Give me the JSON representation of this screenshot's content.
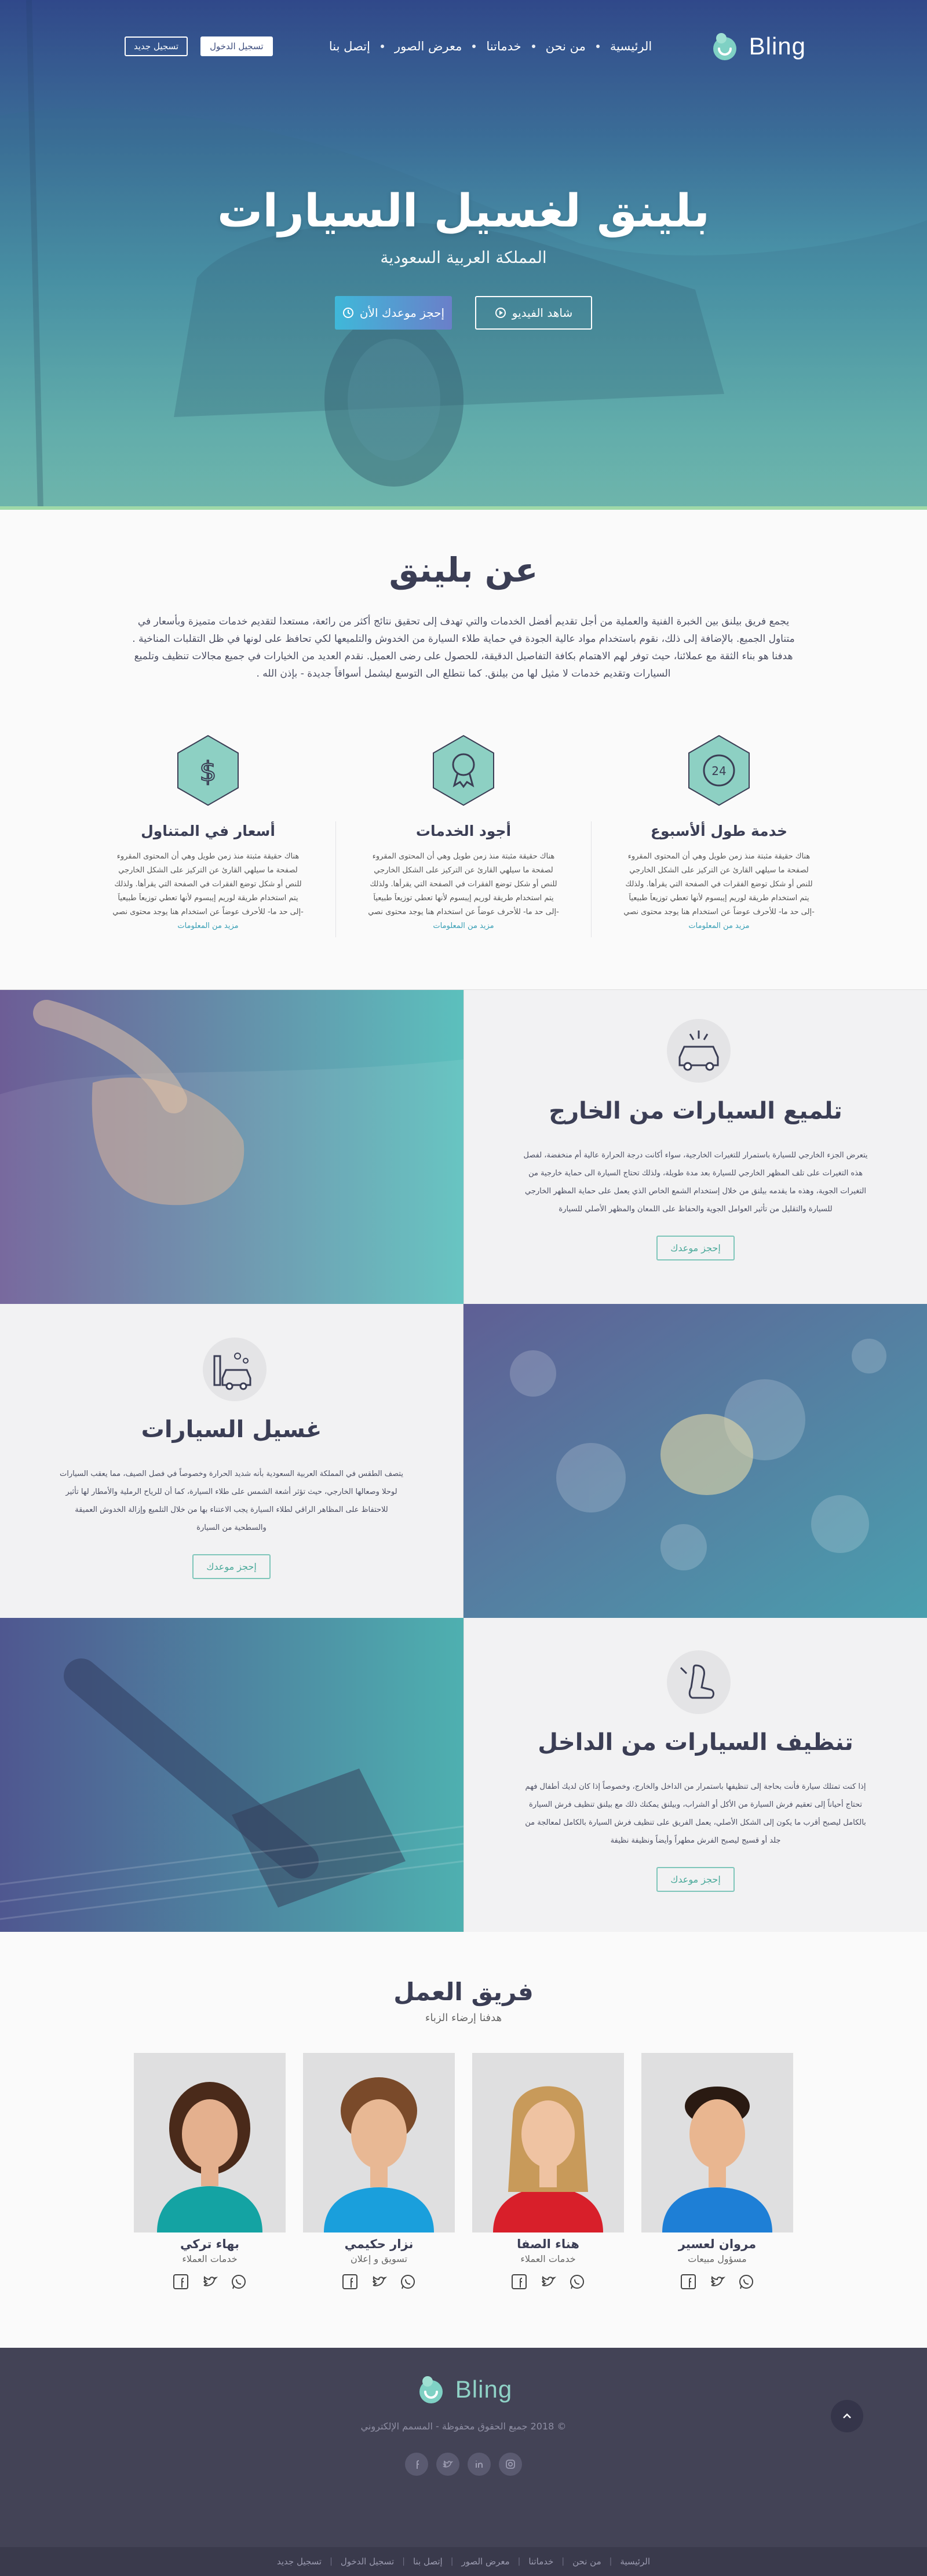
{
  "brand": {
    "name": "Bling",
    "colors": {
      "primary": "#364c8c",
      "accent": "#3fb8d9",
      "mint": "#86cfb7"
    }
  },
  "header": {
    "register_label": "تسجيل جديد",
    "login_label": "تسجيل الدخول",
    "menu": [
      {
        "label": "الرئيسية"
      },
      {
        "label": "من نحن"
      },
      {
        "label": "خدماتنا"
      },
      {
        "label": "معرض الصور"
      },
      {
        "label": "إتصل بنا"
      }
    ]
  },
  "hero": {
    "title": "بلينق لغسيل السيارات",
    "subtitle": "المملكة العربية السعودية",
    "book_label": "إحجز موعدك الأن",
    "video_label": "شاهد الفيديو"
  },
  "about": {
    "title": "عن بلينق",
    "text": "يجمع فريق بيلنق بين الخبرة الفنية والعملية من أجل تقديم أفضل الخدمات والتي تهدف إلى تحقيق نتائج أكثر من رائعة، مستعدا لتقديم خدمات متميزة وبأسعار في متناول الجميع. بالإضافة إلى ذلك، نقوم باستخدام مواد عالية الجودة في حماية طلاء السيارة من الخدوش والتلميعها لكي تحافظ على لونها في ظل التقلبات المناخية . هدفنا هو بناء الثقة مع عملائنا، حيث توفر لهم الاهتمام بكافة التفاصيل الدقيقة، للحصول على رضى العميل. نقدم العديد من الخيارات في جميع مجالات تنظيف وتلميع السيارات وتقديم خدمات لا مثيل لها من بيلنق. كما نتطلع الى التوسع ليشمل أسواقاً جديدة - بإذن الله .",
    "features": [
      {
        "title": "خدمة طول ألأسبوع",
        "text": "هناك حقيقة مثبتة منذ زمن طويل وهي أن المحتوى المقروء لصفحة ما سيلهي القارئ عن التركيز على الشكل الخارجي للنص أو شكل توضع الفقرات في الصفحة التي يقرأها. ولذلك يتم استخدام طريقة لوريم إيبسوم لأنها تعطي توزيعاَ طبيعياَ -إلى حد ما- للأحرف عوضاً عن استخدام هنا يوجد محتوى نصي",
        "link": "مزيد من المعلومات",
        "icon": "clock-24-icon"
      },
      {
        "title": "أجود الخدمات",
        "text": "هناك حقيقة مثبتة منذ زمن طويل وهي أن المحتوى المقروء لصفحة ما سيلهي القارئ عن التركيز على الشكل الخارجي للنص أو شكل توضع الفقرات في الصفحة التي يقرأها. ولذلك يتم استخدام طريقة لوريم إيبسوم لأنها تعطي توزيعاَ طبيعياَ -إلى حد ما- للأحرف عوضاً عن استخدام هنا يوجد محتوى نصي",
        "link": "مزيد من المعلومات",
        "icon": "award-badge-icon"
      },
      {
        "title": "أسعار في المتناول",
        "text": "هناك حقيقة مثبتة منذ زمن طويل وهي أن المحتوى المقروء لصفحة ما سيلهي القارئ عن التركيز على الشكل الخارجي للنص أو شكل توضع الفقرات في الصفحة التي يقرأها. ولذلك يتم استخدام طريقة لوريم إيبسوم لأنها تعطي توزيعاَ طبيعياَ -إلى حد ما- للأحرف عوضاً عن استخدام هنا يوجد محتوى نصي",
        "link": "مزيد من المعلومات",
        "icon": "dollar-icon"
      }
    ]
  },
  "services": [
    {
      "title": "تلميع السيارات من الخارج",
      "text": "يتعرض الجزء الخارجي للسيارة باستمرار للتغيرات الخارجية، سواء أكانت درجة الحرارة عالية أم منخفضة، لفصل هذه التغيرات على تلف المظهر الخارجي للسيارة بعد مدة طويلة، ولذلك تحتاج السيارة الى حماية خارجية من التغيرات الجوية، وهذه ما يقدمه بيلنق من خلال إستخدام الشمع الخاص الذي يعمل على حماية المظهر الخارجي للسيارة والتقليل من تأثير العوامل الجوية والحفاظ على اللمعان والمظهر الأصلي للسيارة",
      "button": "إحجز موعدك",
      "icon": "car-shine-icon"
    },
    {
      "title": "غسيل السيارات",
      "text": "يتصف الطقس في المملكة العربية السعودية بأنه شديد الحرارة وخصوصاً في فصل الصيف، مما يعقب السيارات لوحلا وصعالها الخارجي، حيث تؤثر أشعة الشمس على طلاء السيارة، كما أن للرياح الرملية والأمطار لها تأثير للاحتفاظ على المظاهر الراقي لطلاء السيارة يجب الاعتناء بها من خلال التلميع وإزالة الخدوش العميقة والسطحية من السيارة",
      "button": "إحجز موعدك",
      "icon": "car-wash-icon"
    },
    {
      "title": "تنظيف السيارات من الداخل",
      "text": "إذا كنت تمتلك سيارة فأنت بحاجة إلى تنظيفها باستمرار من الداخل والخارج، وخصوصاً إذا كان لديك أطفال فهم تحتاج أحياناً إلى تعقيم فرش السيارة من الأكل أو الشراب، وبيلنق يمكنك ذلك مع بيلنق تنظيف فرش السيارة بالكامل ليصبح أقرب ما يكون إلى الشكل الأصلي، يعمل الفريق على تنظيف فرش السيارة بالكامل لمعالجة من جلد أو قسيج ليصبح الفرش مطهراً وأيضاً ونظيفة نظيفة",
      "button": "إحجز موعدك",
      "icon": "car-seat-icon"
    }
  ],
  "team": {
    "title": "فريق العمل",
    "subtitle": "هدفنا إرضاء الزباء",
    "members": [
      {
        "name": "مروان لعسير",
        "role": "مسؤول مبيعات"
      },
      {
        "name": "هناء الصفا",
        "role": "خدمات العملاء"
      },
      {
        "name": "نزار حكيمي",
        "role": "تسويق و إعلان"
      },
      {
        "name": "بهاء تركي",
        "role": "خدمات العملاء"
      }
    ]
  },
  "footer": {
    "copyright": "© 2018 جميع الحقوق محفوظة - المسمم الإلكتروني",
    "links": [
      "الرئيسية",
      "من نحن",
      "خدماتنا",
      "معرض الصور",
      "إتصل بنا",
      "تسجيل الدخول",
      "تسجيل جديد"
    ]
  }
}
